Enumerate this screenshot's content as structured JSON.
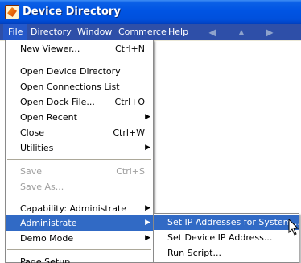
{
  "window": {
    "title": "Device Directory"
  },
  "menubar": {
    "items": [
      {
        "label": "File"
      },
      {
        "label": "Directory"
      },
      {
        "label": "Window"
      },
      {
        "label": "Commerce"
      },
      {
        "label": "Help"
      }
    ],
    "nav": {
      "back_icon": "back-arrow-icon",
      "up_icon": "up-arrow-icon",
      "forward_icon": "forward-arrow-icon"
    }
  },
  "file_menu": {
    "new_viewer": {
      "label": "New Viewer...",
      "accel": "Ctrl+N"
    },
    "open_device_directory": {
      "label": "Open Device Directory"
    },
    "open_connections_list": {
      "label": "Open Connections List"
    },
    "open_dock_file": {
      "label": "Open Dock File...",
      "accel": "Ctrl+O"
    },
    "open_recent": {
      "label": "Open Recent"
    },
    "close": {
      "label": "Close",
      "accel": "Ctrl+W"
    },
    "utilities": {
      "label": "Utilities"
    },
    "save": {
      "label": "Save",
      "accel": "Ctrl+S"
    },
    "save_as": {
      "label": "Save As..."
    },
    "capability": {
      "label": "Capability: Administrate"
    },
    "administrate": {
      "label": "Administrate"
    },
    "demo_mode": {
      "label": "Demo Mode"
    },
    "page_setup": {
      "label": "Page Setup..."
    }
  },
  "submenu": {
    "set_ip_system": {
      "label": "Set IP Addresses for System..."
    },
    "set_device_ip": {
      "label": "Set Device IP Address..."
    },
    "run_script": {
      "label": "Run Script..."
    }
  },
  "colors": {
    "highlight": "#316ac5",
    "menubar": "#2e4fa8",
    "titlebar": "#0054e3"
  }
}
